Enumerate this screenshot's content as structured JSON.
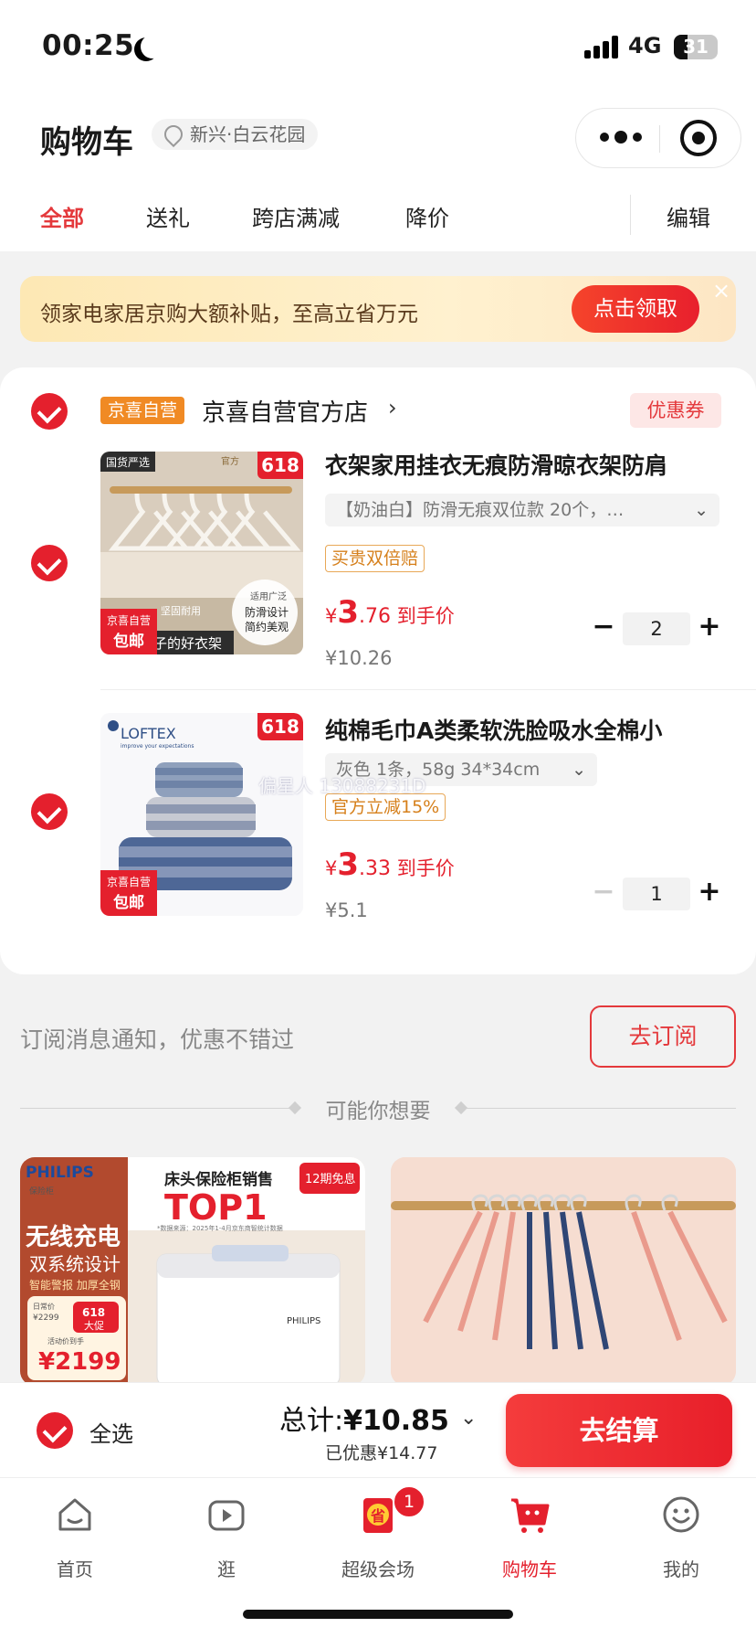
{
  "status_bar": {
    "time": "00:25",
    "network": "4G",
    "battery": "31",
    "battery_level": 0.31
  },
  "header": {
    "title": "购物车",
    "location": "新兴·白云花园",
    "tabs": [
      "全部",
      "送礼",
      "跨店满减",
      "降价"
    ],
    "edit": "编辑"
  },
  "banner": {
    "text": "领家电家居京购大额补贴，至高立省万元",
    "button": "点击领取",
    "close": "×"
  },
  "store": {
    "tag": "京喜自营",
    "name": "京喜自营官方店",
    "arrow": "›",
    "coupon": "优惠券"
  },
  "items": [
    {
      "title": "衣架家用挂衣无痕防滑晾衣架防肩",
      "sku": "【奶油白】防滑无痕双位款 20个，…",
      "promo": "买贵双倍赔",
      "price_symbol": "¥",
      "price_int": "3",
      "price_dec": ".76",
      "price_suffix": "到手价",
      "original_price": "¥10.26",
      "quantity": "2",
      "badge": "618",
      "ship_top": "京喜自营",
      "ship_main": "包邮",
      "thumb_text_1": "国货严选",
      "thumb_text_2": "子的好衣架",
      "thumb_text_3": "适用广泛",
      "thumb_text_4": "防滑设计",
      "thumb_text_5": "简约美观",
      "thumb_text_6": "坚固耐用",
      "thumb_text_7": "官方"
    },
    {
      "title": "纯棉毛巾A类柔软洗脸吸水全棉小",
      "sku": "灰色 1条，58g 34*34cm",
      "promo": "官方立减15%",
      "price_symbol": "¥",
      "price_int": "3",
      "price_dec": ".33",
      "price_suffix": "到手价",
      "original_price": "¥5.1",
      "quantity": "1",
      "badge": "618",
      "ship_top": "京喜自营",
      "ship_main": "包邮",
      "brand": "LOFTEX",
      "brand_sub": "improve your expectations"
    }
  ],
  "watermark": "偏星人 13088231D",
  "subscribe": {
    "text": "订阅消息通知，优惠不错过",
    "button": "去订阅"
  },
  "recommend": {
    "label": "可能你想要",
    "card1": {
      "brand": "PHILIPS",
      "brand_sub": "保险柜",
      "headline": "床头保险柜销售",
      "top": "TOP1",
      "note": "*数据来源：2025年1-4月京东商智统计数据",
      "free": "12期免息",
      "tag1": "无线充电",
      "tag2": "双系统设计",
      "tag3": "智能警报 加厚全钢",
      "day_price_label": "日常价",
      "day_price": "¥2299",
      "promo_618": "618",
      "promo_big": "大促",
      "hand_label": "活动价到手",
      "hand_price": "¥2199",
      "device_brand": "PHILIPS"
    }
  },
  "checkout": {
    "select_all": "全选",
    "total_label": "总计:",
    "total_value": "¥10.85",
    "caret": "⌄",
    "discount": "已优惠¥14.77",
    "pay": "去结算"
  },
  "tabbar": [
    {
      "label": "首页",
      "icon": "home-icon"
    },
    {
      "label": "逛",
      "icon": "video-play-icon"
    },
    {
      "label": "超级会场",
      "icon": "super-venue-icon",
      "badge": "1",
      "icon_text": "省"
    },
    {
      "label": "购物车",
      "icon": "cart-icon"
    },
    {
      "label": "我的",
      "icon": "smiley-icon"
    }
  ],
  "colors": {
    "accent": "#e4202d",
    "tag_orange": "#f08a24",
    "banner_bg": "#fde8b4"
  }
}
